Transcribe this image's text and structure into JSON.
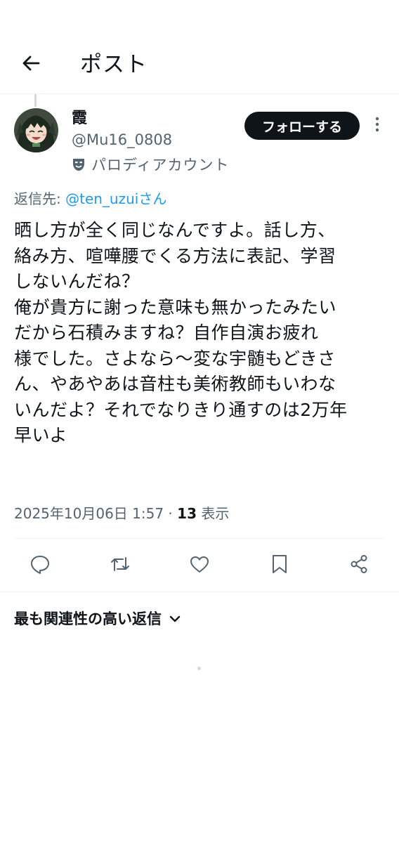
{
  "header": {
    "title": "ポスト",
    "back_icon": "arrow-left-icon"
  },
  "author": {
    "display_name": "霞",
    "handle": "@Mu16_0808",
    "parody_label": "パロディアカウント",
    "parody_icon": "theater-mask-icon"
  },
  "follow_button": {
    "label": "フォローする"
  },
  "reply_to": {
    "prefix": "返信先: ",
    "mention": "@ten_uzui",
    "suffix": "さん"
  },
  "tweet": {
    "text": "晒し方が全く同じなんですよ。話し方、\n絡み方、喧嘩腰でくる方法に表記、学習\nしないんだね？\n俺が貴方に謝った意味も無かったみたい\nだから石積みますね？自作自演お疲れ\n様でした。さよなら〜変な宇髄もどきさ\nん、やあやあは音柱も美術教師もいわな\nいんだよ？それでなりきり通すのは2万年\n早いよ"
  },
  "meta": {
    "timestamp": "2025年10月06日 1:57",
    "separator": " · ",
    "views_count": "13",
    "views_label": " 表示"
  },
  "actions": {
    "icons": [
      "reply-icon",
      "repost-icon",
      "like-icon",
      "bookmark-icon",
      "share-icon"
    ]
  },
  "replies_sort": {
    "label": "最も関連性の高い返信",
    "icon": "chevron-down-icon"
  },
  "colors": {
    "text_primary": "#0f1419",
    "text_secondary": "#536471",
    "accent": "#1d9bf0",
    "divider": "#eff3f4"
  }
}
